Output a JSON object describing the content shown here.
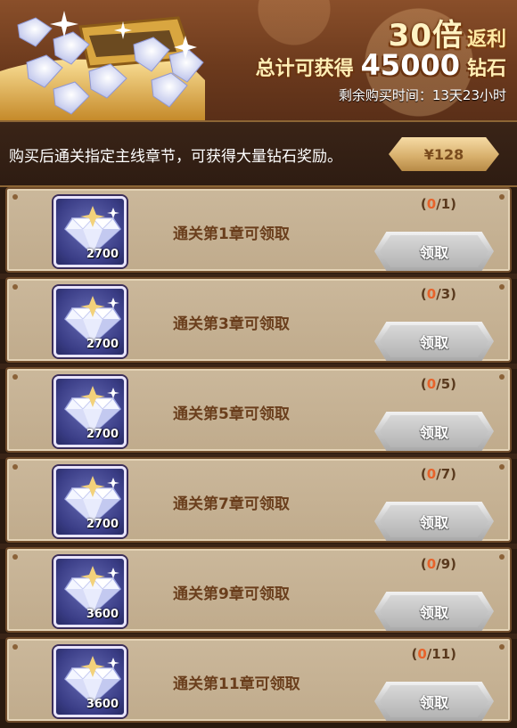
{
  "banner": {
    "multiplier": "30倍",
    "rebate": "返利",
    "total_prefix": "总计可获得",
    "total_amount": "45000",
    "total_suffix": "钻石",
    "time_remaining": "剩余购买时间：13天23小时"
  },
  "info": {
    "description": "购买后通关指定主线章节，可获得大量钻石奖励。",
    "price": "¥128"
  },
  "rewards": [
    {
      "label": "通关第1章可领取",
      "qty": "2700",
      "progress_current": "0",
      "progress_total": "/1",
      "button": "领取"
    },
    {
      "label": "通关第3章可领取",
      "qty": "2700",
      "progress_current": "0",
      "progress_total": "/3",
      "button": "领取"
    },
    {
      "label": "通关第5章可领取",
      "qty": "2700",
      "progress_current": "0",
      "progress_total": "/5",
      "button": "领取"
    },
    {
      "label": "通关第7章可领取",
      "qty": "2700",
      "progress_current": "0",
      "progress_total": "/7",
      "button": "领取"
    },
    {
      "label": "通关第9章可领取",
      "qty": "3600",
      "progress_current": "0",
      "progress_total": "/9",
      "button": "领取"
    },
    {
      "label": "通关第11章可领取",
      "qty": "3600",
      "progress_current": "0",
      "progress_total": "/11",
      "button": "领取"
    }
  ],
  "icons": {
    "reward": "diamond-icon",
    "banner": "treasure-chest-icon"
  },
  "colors": {
    "progress_current": "#e8632a",
    "label": "#6a3e1c",
    "button_disabled": "#b4b4b4"
  }
}
